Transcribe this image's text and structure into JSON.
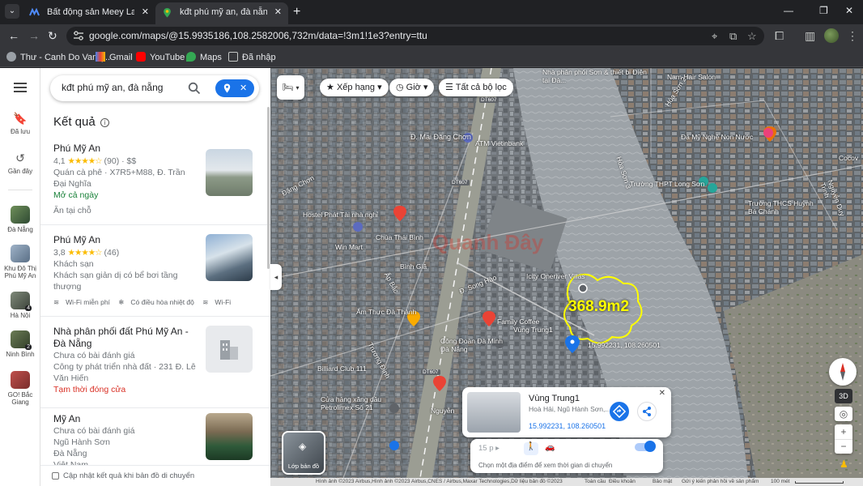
{
  "browser": {
    "tabs": [
      {
        "title": "Bất động sản Meey Land - Nền",
        "active": false
      },
      {
        "title": "kđt phú mỹ an, đà nẵng - Goog",
        "active": true
      }
    ],
    "url": "google.com/maps/@15.9935186,108.2582006,732m/data=!3m1!1e3?entry=ttu",
    "bookmarks": [
      "Thư - Canh Do Van (...",
      "Gmail",
      "YouTube",
      "Maps",
      "Đã nhập"
    ]
  },
  "rail": {
    "saved_label": "Đã lưu",
    "recent_label": "Gần đây",
    "places": [
      {
        "label": "Đà Nẵng",
        "badge": ""
      },
      {
        "label": "Khu Đô Thị Phú Mỹ An",
        "badge": ""
      },
      {
        "label": "Hà Nội",
        "badge": "4"
      },
      {
        "label": "Ninh Bình",
        "badge": "2"
      },
      {
        "label": "GO! Bắc Giang",
        "badge": ""
      }
    ]
  },
  "search": {
    "value": "kđt phú mỹ an, đà nẵng"
  },
  "results_heading": "Kết quả",
  "results": [
    {
      "name": "Phú Mỹ An",
      "rating": "4,1",
      "stars": "★★★★☆",
      "reviews": "(90)",
      "price": "· $$",
      "type_addr": "Quán cà phê · X7R5+M88, Đ. Trần Đại Nghĩa",
      "status": "Mở cả ngày",
      "extra": "Ăn tại chỗ"
    },
    {
      "name": "Phú Mỹ An",
      "rating": "3,8",
      "stars": "★★★★☆",
      "reviews": "(46)",
      "type": "Khách sạn",
      "desc": "Khách sạn giản dị có bể bơi tầng thượng",
      "amenities": [
        "Wi-Fi miễn phí",
        "Có điều hòa nhiệt độ",
        "Wi-Fi"
      ]
    },
    {
      "name": "Nhà phân phối đất Phú Mỹ An - Đà Nẵng",
      "no_review": "Chưa có bài đánh giá",
      "type_addr": "Công ty phát triển nhà đất · 231 Đ. Lê Văn Hiến",
      "status": "Tạm thời đóng cửa"
    },
    {
      "name": "Mỹ An",
      "no_review": "Chưa có bài đánh giá",
      "line2": "Ngũ Hành Sơn",
      "line3": "Đà Nẵng",
      "line4": "Việt Nam"
    }
  ],
  "update_checkbox": "Cập nhật kết quả khi bản đồ di chuyển",
  "filters": {
    "sort": "Xếp hạng",
    "hours": "Giờ",
    "all": "Tất cả bộ lọc"
  },
  "map_labels": [
    "Nhà phân phối Sơn & thiết bị Điện tại Đà...",
    "Nam Hair Salon",
    "Đ. Mai Đăng Chơn",
    "ATM Vietinbank",
    "Đá Mỹ Nghệ Non Nước",
    "Cocov",
    "Trường THPT Long Sơn",
    "Trường THCS Huỳnh Bá Chánh",
    "Hostel Phát Tài nhà nghỉ",
    "Chùa Thái Bình",
    "Win Mart",
    "Bình Giã",
    "Icity Oneriver Villas",
    "Ẩm Thực Đà Thành",
    "Family Coffee",
    "Vùng Trung1",
    "Công Đoàn Đà Minh Đà Nẵng",
    "Billiard Club 111",
    "Cửa hàng xăng dầu Petrolimex Số 21",
    "Nguyễn",
    "Đ. Song Hào",
    "DT607",
    "Đặng Chơn",
    "Hòa Sơn 3",
    "Hòa Sơn 2",
    "Nguyễn Duy Trinh",
    "Trương Đình",
    "Ấp Bắc"
  ],
  "overlay": {
    "area": "368.9m2",
    "coords": "15.992231, 108.260501",
    "watermark": "Quanh Đây"
  },
  "place_card": {
    "title": "Vùng Trung1",
    "address": "Hoà Hải, Ngũ Hành Sơn,...",
    "coords": "15.992231, 108.260501"
  },
  "travel": {
    "time": "15 p",
    "hint": "Chọn một địa điểm để xem thời gian di chuyển"
  },
  "layers_label": "Lớp bản đồ",
  "btn_3d": "3D",
  "footer": {
    "attribution": "Hình ảnh ©2023 Airbus,Hình ảnh ©2023 Airbus,CNES / Airbus,Maxar Technologies,Dữ liệu bản đồ ©2023",
    "global": "Toàn cầu",
    "terms": "Điều khoản",
    "privacy": "Bảo mật",
    "feedback": "Gửi ý kiến phản hồi về sản phẩm",
    "scale": "100 mét"
  },
  "colors": {
    "accent": "#1a73e8",
    "open": "#188038",
    "closed": "#d93025",
    "star": "#fbbc04",
    "area_line": "#ffff00"
  }
}
